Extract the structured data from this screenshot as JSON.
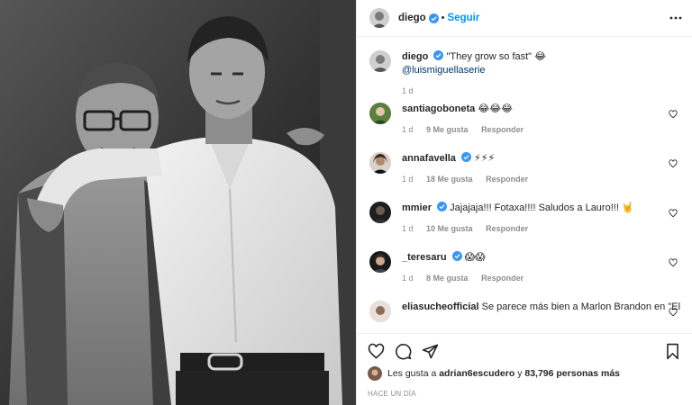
{
  "header": {
    "username": "diego",
    "separator": "•",
    "follow_label": "Seguir"
  },
  "caption": {
    "username": "diego",
    "text": "\"They grow so fast\" 😂",
    "mention": "@luismiguellaserie",
    "time": "1 d"
  },
  "comments": [
    {
      "username": "santiagoboneta",
      "text": "😂😂😂",
      "time": "1 d",
      "likes": "9 Me gusta",
      "reply": "Responder"
    },
    {
      "username": "annafavella",
      "text": "⚡⚡⚡",
      "time": "1 d",
      "likes": "18 Me gusta",
      "reply": "Responder"
    },
    {
      "username": "mmier",
      "text": "Jajajaja!!! Fotaxa!!!! Saludos a Lauro!!! 🤘",
      "time": "1 d",
      "likes": "10 Me gusta",
      "reply": "Responder"
    },
    {
      "username": "_teresaru",
      "text": "😱😱",
      "time": "1 d",
      "likes": "8 Me gusta",
      "reply": "Responder"
    },
    {
      "username": "eliasucheofficial",
      "text": "Se parece más bien a Marlon Brandon en \"El",
      "time": "",
      "likes": "",
      "reply": ""
    }
  ],
  "likes_line": {
    "prefix": "Les gusta a ",
    "user": "adrian6escudero",
    "middle": " y ",
    "count": "83,796 personas más"
  },
  "posted_ago": "HACE UN DÍA",
  "icons": {
    "more": "more-horizontal-icon",
    "like": "heart-icon",
    "comment": "comment-icon",
    "share": "share-icon",
    "save": "bookmark-icon",
    "verified": "verified-badge-icon"
  },
  "colors": {
    "accent": "#0095f6",
    "verified": "#3897f0",
    "muted": "#8e8e8e",
    "text": "#262626"
  }
}
